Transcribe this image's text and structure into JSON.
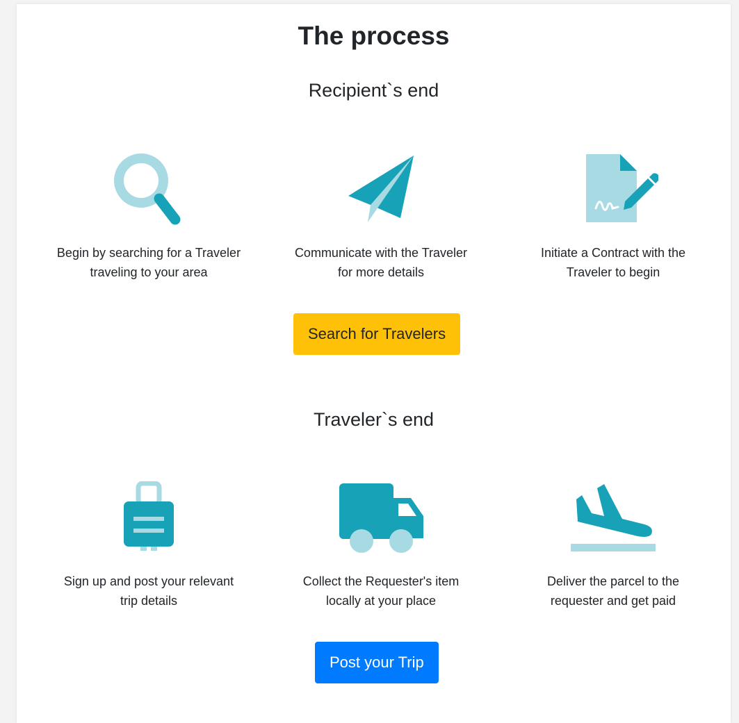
{
  "page": {
    "title": "The process"
  },
  "recipient": {
    "heading": "Recipient`s end",
    "steps": [
      {
        "icon": "magnifier-icon",
        "line1": "Begin by searching for a Traveler",
        "line2": "traveling to your area"
      },
      {
        "icon": "paper-plane-icon",
        "line1": "Communicate with the Traveler",
        "line2": "for more details"
      },
      {
        "icon": "contract-sign-icon",
        "line1": "Initiate a Contract with the",
        "line2": "Traveler to begin"
      }
    ],
    "button_label": "Search for Travelers"
  },
  "traveler": {
    "heading": "Traveler`s end",
    "steps": [
      {
        "icon": "suitcase-icon",
        "line1": "Sign up and post your relevant",
        "line2": "trip details"
      },
      {
        "icon": "truck-icon",
        "line1": "Collect the Requester's item",
        "line2": "locally at your place"
      },
      {
        "icon": "plane-landing-icon",
        "line1": "Deliver the parcel to the",
        "line2": "requester and get paid"
      }
    ],
    "button_label": "Post your Trip"
  },
  "colors": {
    "icon_dark": "#17a2b8",
    "icon_light": "#a8dae3",
    "button_warning": "#ffc107",
    "button_primary": "#007bff"
  }
}
